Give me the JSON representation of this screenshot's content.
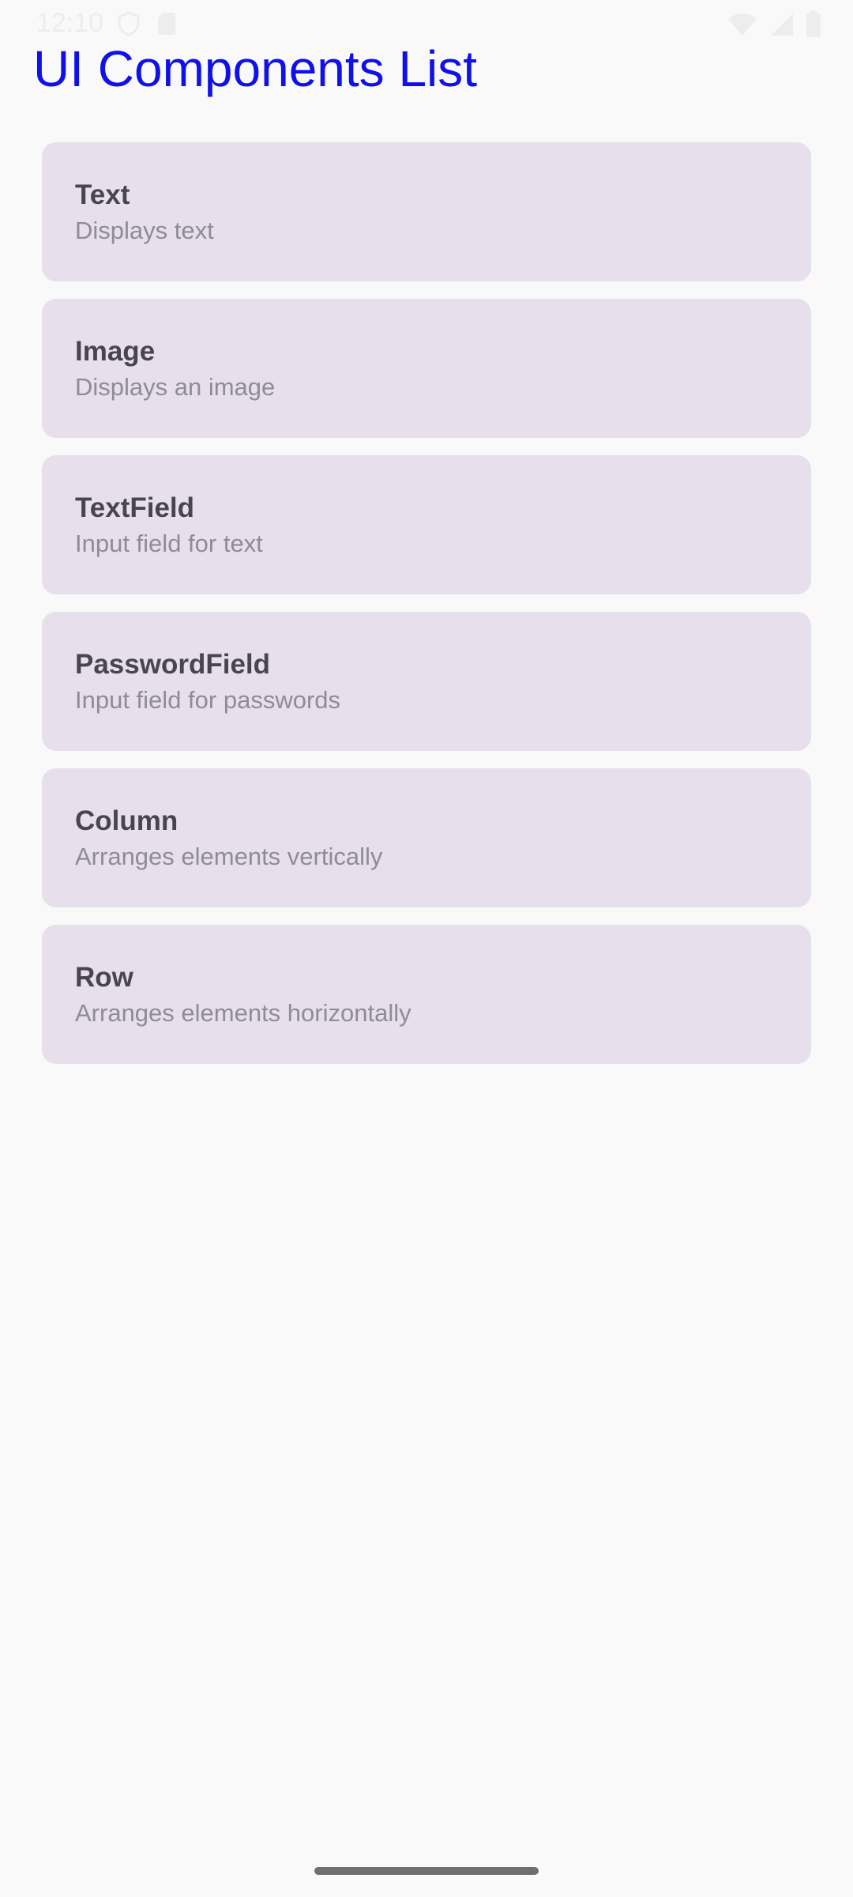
{
  "status_bar": {
    "time": "12:10",
    "icons": [
      "shield-icon",
      "sd-card-icon",
      "wifi-icon",
      "cellular-signal-icon",
      "battery-icon"
    ]
  },
  "page": {
    "title": "UI Components List"
  },
  "components": [
    {
      "title": "Text",
      "description": "Displays text"
    },
    {
      "title": "Image",
      "description": "Displays an image"
    },
    {
      "title": "TextField",
      "description": "Input field for text"
    },
    {
      "title": "PasswordField",
      "description": "Input field for passwords"
    },
    {
      "title": "Column",
      "description": "Arranges elements vertically"
    },
    {
      "title": "Row",
      "description": "Arranges elements horizontally"
    }
  ],
  "colors": {
    "title": "#1010e8",
    "card_background": "#e7dfec",
    "card_title": "#49454f",
    "card_description": "#8f8c93",
    "background": "#f9f9f9"
  }
}
